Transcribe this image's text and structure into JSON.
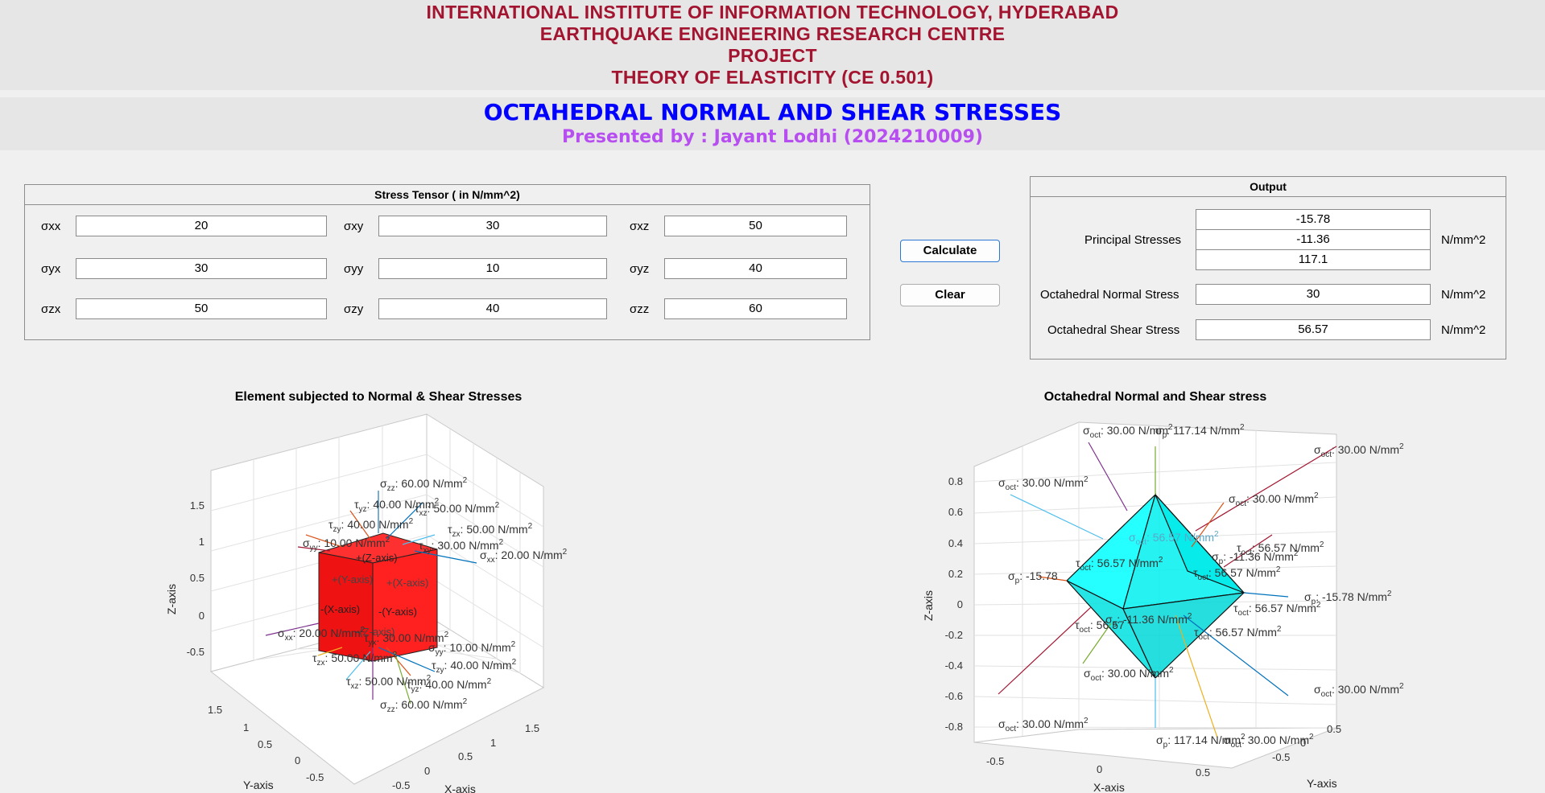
{
  "header": {
    "line1": "INTERNATIONAL INSTITUTE OF INFORMATION TECHNOLOGY, HYDERABAD",
    "line2": "EARTHQUAKE ENGINEERING RESEARCH CENTRE",
    "line3": "PROJECT",
    "line4": "THEORY OF ELASTICITY (CE 0.501)"
  },
  "title": {
    "main": "OCTAHEDRAL NORMAL AND SHEAR STRESSES",
    "presenter": "Presented by : Jayant Lodhi (2024210009)"
  },
  "stress_panel": {
    "title": "Stress Tensor ( in N/mm^2)",
    "cells": [
      {
        "label": "σxx",
        "value": "20"
      },
      {
        "label": "σxy",
        "value": "30"
      },
      {
        "label": "σxz",
        "value": "50"
      },
      {
        "label": "σyx",
        "value": "30"
      },
      {
        "label": "σyy",
        "value": "10"
      },
      {
        "label": "σyz",
        "value": "40"
      },
      {
        "label": "σzx",
        "value": "50"
      },
      {
        "label": "σzy",
        "value": "40"
      },
      {
        "label": "σzz",
        "value": "60"
      }
    ]
  },
  "buttons": {
    "calculate": "Calculate",
    "clear": "Clear"
  },
  "output_panel": {
    "title": "Output",
    "principal_label": "Principal Stresses",
    "principal_values": [
      "-15.78",
      "-11.36",
      "117.1"
    ],
    "normal_label": "Octahedral Normal Stress",
    "normal_value": "30",
    "shear_label": "Octahedral Shear Stress",
    "shear_value": "56.57",
    "unit": "N/mm^2"
  },
  "plot_left": {
    "title": "Element subjected to Normal & Shear Stresses",
    "xlabel": "X-axis",
    "ylabel": "Y-axis",
    "zlabel": "Z-axis",
    "z_ticks": [
      "1.5",
      "1",
      "0.5",
      "0",
      "-0.5"
    ],
    "y_ticks": [
      "1.5",
      "1",
      "0.5",
      "0",
      "-0.5"
    ],
    "x_ticks": [
      "-0.5",
      "0",
      "0.5",
      "1",
      "1.5"
    ],
    "face_labels": [
      "+(Z-axis)",
      "+(Y-axis)",
      "+(X-axis)",
      "-(X-axis)",
      "-(Y-axis)",
      "-(Z-axis)"
    ],
    "annotations": [
      {
        "sym": "σ",
        "sub": "zz",
        "val": "60.00 N/mm",
        "sup": "2"
      },
      {
        "sym": "τ",
        "sub": "yz",
        "val": "40.00 N/mm",
        "sup": "2"
      },
      {
        "sym": "τ",
        "sub": "xz",
        "val": "50.00 N/mm",
        "sup": "2"
      },
      {
        "sym": "τ",
        "sub": "zy",
        "val": "40.00 N/mm",
        "sup": "2"
      },
      {
        "sym": "τ",
        "sub": "zx",
        "val": "50.00 N/mm",
        "sup": "2"
      },
      {
        "sym": "σ",
        "sub": "yy",
        "val": "10.00 N/mm",
        "sup": "2"
      },
      {
        "sym": "τ",
        "sub": "xy",
        "val": "30.00 N/mm",
        "sup": "2"
      },
      {
        "sym": "σ",
        "sub": "xx",
        "val": "20.00 N/mm",
        "sup": "2"
      },
      {
        "sym": "σ",
        "sub": "xx",
        "val": "20.00 N/mm",
        "sup": "2"
      },
      {
        "sym": "τ",
        "sub": "yx",
        "val": "30.00 N/mm",
        "sup": "2"
      },
      {
        "sym": "σ",
        "sub": "yy",
        "val": "10.00 N/mm",
        "sup": "2"
      },
      {
        "sym": "τ",
        "sub": "zx",
        "val": "50.00 N/mm",
        "sup": "2"
      },
      {
        "sym": "τ",
        "sub": "zy",
        "val": "40.00 N/mm",
        "sup": "2"
      },
      {
        "sym": "τ",
        "sub": "xz",
        "val": "50.00 N/mm",
        "sup": "2"
      },
      {
        "sym": "τ",
        "sub": "yz",
        "val": "40.00 N/mm",
        "sup": "2"
      },
      {
        "sym": "σ",
        "sub": "zz",
        "val": "60.00 N/mm",
        "sup": "2"
      }
    ]
  },
  "plot_right": {
    "title": "Octahedral Normal and Shear stress",
    "xlabel": "X-axis",
    "ylabel": "Y-axis",
    "zlabel": "Z-axis",
    "z_ticks": [
      "0.8",
      "0.6",
      "0.4",
      "0.2",
      "0",
      "-0.2",
      "-0.4",
      "-0.6",
      "-0.8"
    ],
    "x_ticks": [
      "-0.5",
      "0",
      "0.5"
    ],
    "y_ticks": [
      "0.5",
      "0",
      "-0.5"
    ],
    "annotations": [
      {
        "sym": "σ",
        "sub": "oct",
        "val": "30.00 N/mm",
        "sup": "2"
      },
      {
        "sym": "σ",
        "sub": "p",
        "val": "117.14 N/mm",
        "sup": "2"
      },
      {
        "sym": "σ",
        "sub": "oct",
        "val": "30.00 N/mm",
        "sup": "2"
      },
      {
        "sym": "σ",
        "sub": "oct",
        "val": "30.00 N/mm",
        "sup": "2"
      },
      {
        "sym": "σ",
        "sub": "oct",
        "val": "30.00 N/mm",
        "sup": "2"
      },
      {
        "sym": "σ",
        "sub": "oct",
        "val": "56.57 N/mm",
        "sup": "2"
      },
      {
        "sym": "τ",
        "sub": "oct",
        "val": "56.57 N/mm",
        "sup": "2"
      },
      {
        "sym": "σ",
        "sub": "p",
        "val": "-11.36 N/mm",
        "sup": "2"
      },
      {
        "sym": "σ",
        "sub": "p",
        "val": "-15.78",
        "sup": ""
      },
      {
        "sym": "τ",
        "sub": "oct",
        "val": "56.57 N/mm",
        "sup": "2"
      },
      {
        "sym": "τ",
        "sub": "oct",
        "val": "56.57 N/mm",
        "sup": "2"
      },
      {
        "sym": "σ",
        "sub": "p",
        "val": "-15.78 N/mm",
        "sup": "2"
      },
      {
        "sym": "τ",
        "sub": "oct",
        "val": "56.57 N/mm",
        "sup": "2"
      },
      {
        "sym": "τ",
        "sub": "oct",
        "val": "56.57",
        "sup": ""
      },
      {
        "sym": "σ",
        "sub": "p",
        "val": "-11.36 N/mm",
        "sup": "2"
      },
      {
        "sym": "τ",
        "sub": "oct",
        "val": "56.57 N/mm",
        "sup": "2"
      },
      {
        "sym": "σ",
        "sub": "oct",
        "val": "30.00 N/mm",
        "sup": "2"
      },
      {
        "sym": "σ",
        "sub": "oct",
        "val": "30.00 N/mm",
        "sup": "2"
      },
      {
        "sym": "σ",
        "sub": "oct",
        "val": "30.00 N/mm",
        "sup": "2"
      },
      {
        "sym": "σ",
        "sub": "p",
        "val": "117.14 N/mm",
        "sup": "2"
      },
      {
        "sym": "σ",
        "sub": "oct",
        "val": "30.00 N/mm",
        "sup": "2"
      }
    ]
  }
}
